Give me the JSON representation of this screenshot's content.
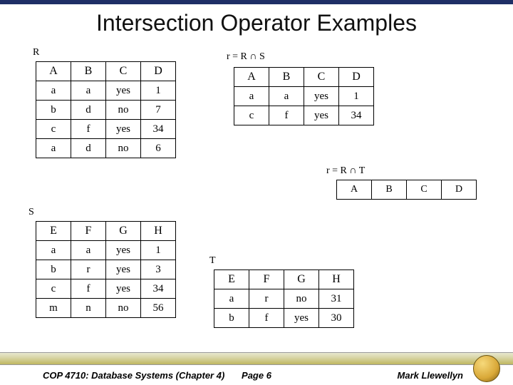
{
  "title": "Intersection Operator Examples",
  "labels": {
    "R": "R",
    "S": "S",
    "T": "T",
    "r_rs": "r = R ∩ S",
    "r_rt": "r = R ∩ T"
  },
  "tables": {
    "R": {
      "headers": [
        "A",
        "B",
        "C",
        "D"
      ],
      "rows": [
        [
          "a",
          "a",
          "yes",
          "1"
        ],
        [
          "b",
          "d",
          "no",
          "7"
        ],
        [
          "c",
          "f",
          "yes",
          "34"
        ],
        [
          "a",
          "d",
          "no",
          "6"
        ]
      ]
    },
    "S": {
      "headers": [
        "E",
        "F",
        "G",
        "H"
      ],
      "rows": [
        [
          "a",
          "a",
          "yes",
          "1"
        ],
        [
          "b",
          "r",
          "yes",
          "3"
        ],
        [
          "c",
          "f",
          "yes",
          "34"
        ],
        [
          "m",
          "n",
          "no",
          "56"
        ]
      ]
    },
    "RS": {
      "headers": [
        "A",
        "B",
        "C",
        "D"
      ],
      "rows": [
        [
          "a",
          "a",
          "yes",
          "1"
        ],
        [
          "c",
          "f",
          "yes",
          "34"
        ]
      ]
    },
    "RT": {
      "headers": [
        "A",
        "B",
        "C",
        "D"
      ],
      "rows": []
    },
    "T": {
      "headers": [
        "E",
        "F",
        "G",
        "H"
      ],
      "rows": [
        [
          "a",
          "r",
          "no",
          "31"
        ],
        [
          "b",
          "f",
          "yes",
          "30"
        ]
      ]
    }
  },
  "footer": {
    "left": "COP 4710: Database Systems  (Chapter 4)",
    "center": "Page 6",
    "right": "Mark Llewellyn"
  },
  "chart_data": [
    {
      "type": "table",
      "name": "R",
      "headers": [
        "A",
        "B",
        "C",
        "D"
      ],
      "rows": [
        [
          "a",
          "a",
          "yes",
          1
        ],
        [
          "b",
          "d",
          "no",
          7
        ],
        [
          "c",
          "f",
          "yes",
          34
        ],
        [
          "a",
          "d",
          "no",
          6
        ]
      ]
    },
    {
      "type": "table",
      "name": "S",
      "headers": [
        "E",
        "F",
        "G",
        "H"
      ],
      "rows": [
        [
          "a",
          "a",
          "yes",
          1
        ],
        [
          "b",
          "r",
          "yes",
          3
        ],
        [
          "c",
          "f",
          "yes",
          34
        ],
        [
          "m",
          "n",
          "no",
          56
        ]
      ]
    },
    {
      "type": "table",
      "name": "R ∩ S",
      "headers": [
        "A",
        "B",
        "C",
        "D"
      ],
      "rows": [
        [
          "a",
          "a",
          "yes",
          1
        ],
        [
          "c",
          "f",
          "yes",
          34
        ]
      ]
    },
    {
      "type": "table",
      "name": "R ∩ T",
      "headers": [
        "A",
        "B",
        "C",
        "D"
      ],
      "rows": []
    },
    {
      "type": "table",
      "name": "T",
      "headers": [
        "E",
        "F",
        "G",
        "H"
      ],
      "rows": [
        [
          "a",
          "r",
          "no",
          31
        ],
        [
          "b",
          "f",
          "yes",
          30
        ]
      ]
    }
  ]
}
